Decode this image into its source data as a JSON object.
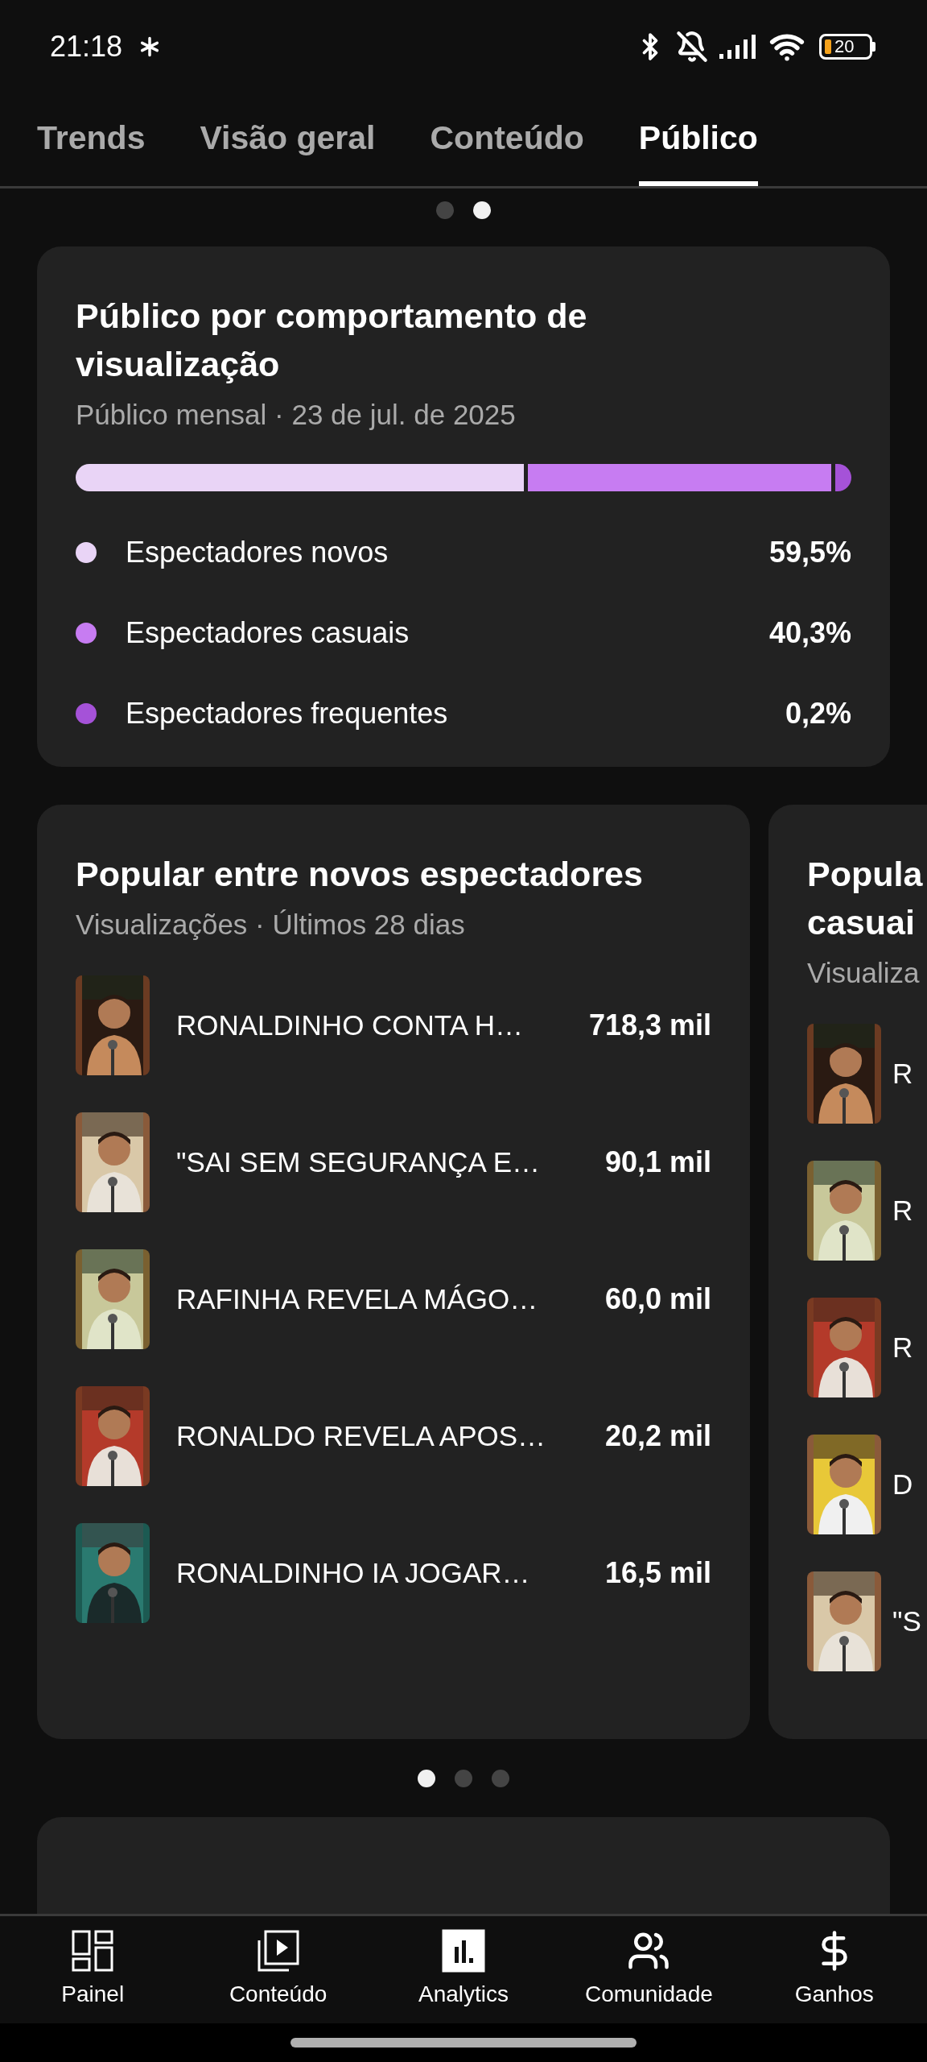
{
  "status_bar": {
    "time": "21:18",
    "battery": "20"
  },
  "tabs": [
    {
      "label": "Trends",
      "selected": false
    },
    {
      "label": "Visão geral",
      "selected": false
    },
    {
      "label": "Conteúdo",
      "selected": false
    },
    {
      "label": "Público",
      "selected": true
    }
  ],
  "top_pager": [
    {
      "selected": false
    },
    {
      "selected": true
    }
  ],
  "behavior_card": {
    "title": "Público por comportamento de visualização",
    "subtitle": "Público mensal · 23 de jul. de 2025",
    "segments": [
      {
        "label": "Espectadores novos",
        "value": "59,5%",
        "color": "#e9d4f6"
      },
      {
        "label": "Espectadores casuais",
        "value": "40,3%",
        "color": "#c77cf2"
      },
      {
        "label": "Espectadores frequentes",
        "value": "0,2%",
        "color": "#a552d8"
      }
    ]
  },
  "popular_cards": [
    {
      "title": "Popular entre novos espectadores",
      "subtitle": "Visualizações · Últimos 28 dias",
      "rows": [
        {
          "title": "RONALDINHO CONTA H…",
          "views": "718,3 mil"
        },
        {
          "title": "\"SAI SEM SEGURANÇA E…",
          "views": "90,1 mil"
        },
        {
          "title": "RAFINHA REVELA MÁGO…",
          "views": "60,0 mil"
        },
        {
          "title": "RONALDO REVELA APOS…",
          "views": "20,2 mil"
        },
        {
          "title": "RONALDINHO IA JOGAR…",
          "views": "16,5 mil"
        }
      ]
    },
    {
      "title_lines": [
        "Popula",
        "casuai"
      ],
      "subtitle": "Visualiza",
      "rows": [
        {
          "title": "R"
        },
        {
          "title": "R"
        },
        {
          "title": "R"
        },
        {
          "title": "D"
        },
        {
          "title": "\"S"
        }
      ]
    }
  ],
  "card_pager": [
    {
      "selected": true
    },
    {
      "selected": false
    },
    {
      "selected": false
    }
  ],
  "bottom_nav": [
    {
      "label": "Painel",
      "kind": "dashboard",
      "selected": false
    },
    {
      "label": "Conteúdo",
      "kind": "content",
      "selected": false
    },
    {
      "label": "Analytics",
      "kind": "analytics",
      "selected": true
    },
    {
      "label": "Comunidade",
      "kind": "community",
      "selected": false
    },
    {
      "label": "Ganhos",
      "kind": "earnings",
      "selected": false
    }
  ]
}
